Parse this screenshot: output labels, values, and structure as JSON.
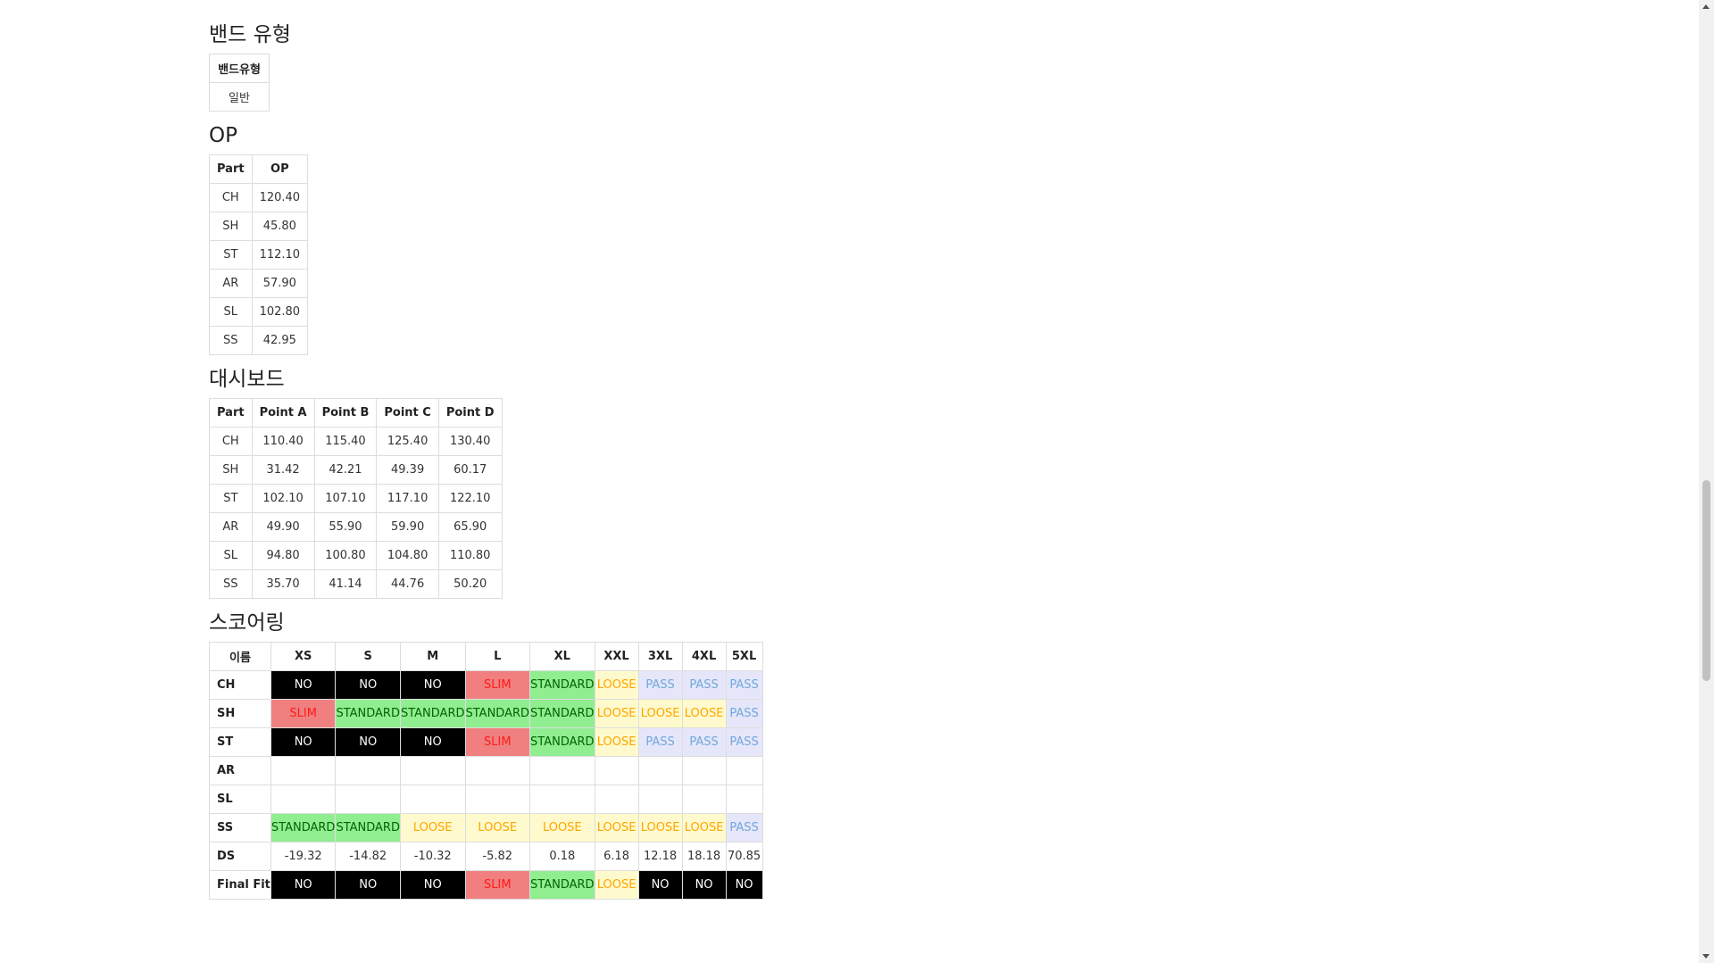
{
  "band_section": {
    "title": "밴드 유형",
    "header": "밴드유형",
    "value": "일반"
  },
  "op_section": {
    "title": "OP",
    "headers": [
      "Part",
      "OP"
    ],
    "rows": [
      [
        "CH",
        "120.40"
      ],
      [
        "SH",
        "45.80"
      ],
      [
        "ST",
        "112.10"
      ],
      [
        "AR",
        "57.90"
      ],
      [
        "SL",
        "102.80"
      ],
      [
        "SS",
        "42.95"
      ]
    ]
  },
  "dashboard_section": {
    "title": "대시보드",
    "headers": [
      "Part",
      "Point A",
      "Point B",
      "Point C",
      "Point D"
    ],
    "rows": [
      [
        "CH",
        "110.40",
        "115.40",
        "125.40",
        "130.40"
      ],
      [
        "SH",
        "31.42",
        "42.21",
        "49.39",
        "60.17"
      ],
      [
        "ST",
        "102.10",
        "107.10",
        "117.10",
        "122.10"
      ],
      [
        "AR",
        "49.90",
        "55.90",
        "59.90",
        "65.90"
      ],
      [
        "SL",
        "94.80",
        "100.80",
        "104.80",
        "110.80"
      ],
      [
        "SS",
        "35.70",
        "41.14",
        "44.76",
        "50.20"
      ]
    ]
  },
  "scoring_section": {
    "title": "스코어링",
    "headers": [
      "이름",
      "XS",
      "S",
      "M",
      "L",
      "XL",
      "XXL",
      "3XL",
      "4XL",
      "5XL"
    ],
    "rows": [
      [
        "CH",
        "NO",
        "NO",
        "NO",
        "SLIM",
        "STANDARD",
        "LOOSE",
        "PASS",
        "PASS",
        "PASS"
      ],
      [
        "SH",
        "SLIM",
        "STANDARD",
        "STANDARD",
        "STANDARD",
        "STANDARD",
        "LOOSE",
        "LOOSE",
        "LOOSE",
        "PASS"
      ],
      [
        "ST",
        "NO",
        "NO",
        "NO",
        "SLIM",
        "STANDARD",
        "LOOSE",
        "PASS",
        "PASS",
        "PASS"
      ],
      [
        "AR",
        "",
        "",
        "",
        "",
        "",
        "",
        "",
        "",
        ""
      ],
      [
        "SL",
        "",
        "",
        "",
        "",
        "",
        "",
        "",
        "",
        ""
      ],
      [
        "SS",
        "STANDARD",
        "STANDARD",
        "LOOSE",
        "LOOSE",
        "LOOSE",
        "LOOSE",
        "LOOSE",
        "LOOSE",
        "PASS"
      ],
      [
        "DS",
        "-19.32",
        "-14.82",
        "-10.32",
        "-5.82",
        "0.18",
        "6.18",
        "12.18",
        "18.18",
        "70.85"
      ],
      [
        "Final Fit",
        "NO",
        "NO",
        "NO",
        "SLIM",
        "STANDARD",
        "LOOSE",
        "NO",
        "NO",
        "NO"
      ]
    ]
  },
  "status_colors": {
    "NO": {
      "bg": "#000000",
      "fg": "#ffffff"
    },
    "SLIM": {
      "bg": "#f08080",
      "fg": "#ff1a1a"
    },
    "STANDARD": {
      "bg": "#90ee90",
      "fg": "#006400"
    },
    "LOOSE": {
      "bg": "#fffacd",
      "fg": "#ffa500"
    },
    "PASS": {
      "bg": "#e6e6fa",
      "fg": "#6fa8dc"
    }
  }
}
